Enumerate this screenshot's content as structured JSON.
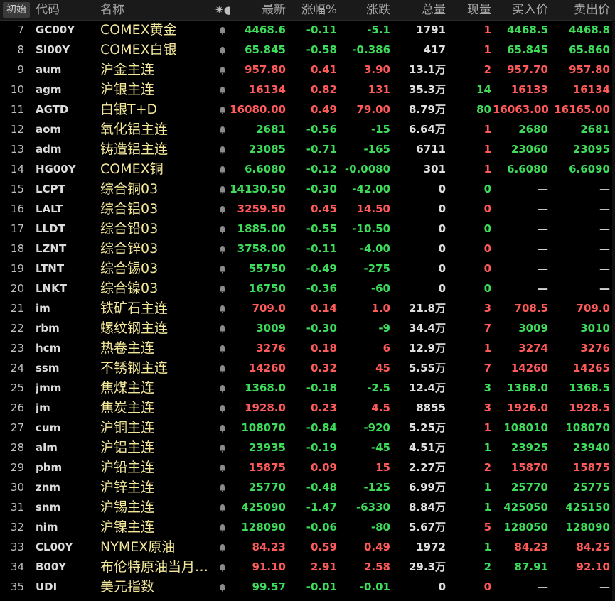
{
  "header": {
    "init_button": "初始",
    "code": "代码",
    "name": "名称",
    "flag": "✷●",
    "last": "最新",
    "pct": "涨幅%",
    "chg": "涨跌",
    "vol": "总量",
    "cur": "现量",
    "bid": "买入价",
    "ask": "卖出价"
  },
  "colors": {
    "up": "#ff5a5a",
    "down": "#3ddc5a",
    "name": "#f3e79a",
    "background": "#000000"
  },
  "rows": [
    {
      "idx": "7",
      "code": "GC00Y",
      "name": "COMEX黄金",
      "last": "4468.6",
      "pct": "-0.11",
      "chg": "-5.1",
      "vol": "1791",
      "cur": "1",
      "bid": "4468.5",
      "ask": "4468.8",
      "dir": "down",
      "cur_dir": "up",
      "bid_dir": "down",
      "ask_dir": "down"
    },
    {
      "idx": "8",
      "code": "SI00Y",
      "name": "COMEX白银",
      "last": "65.845",
      "pct": "-0.58",
      "chg": "-0.386",
      "vol": "417",
      "cur": "1",
      "bid": "65.845",
      "ask": "65.860",
      "dir": "down",
      "cur_dir": "up",
      "bid_dir": "down",
      "ask_dir": "down"
    },
    {
      "idx": "9",
      "code": "aum",
      "name": "沪金主连",
      "last": "957.80",
      "pct": "0.41",
      "chg": "3.90",
      "vol": "13.1万",
      "cur": "2",
      "bid": "957.70",
      "ask": "957.80",
      "dir": "up",
      "cur_dir": "up",
      "bid_dir": "up",
      "ask_dir": "up"
    },
    {
      "idx": "10",
      "code": "agm",
      "name": "沪银主连",
      "last": "16134",
      "pct": "0.82",
      "chg": "131",
      "vol": "35.3万",
      "cur": "14",
      "bid": "16133",
      "ask": "16134",
      "dir": "up",
      "cur_dir": "down",
      "bid_dir": "up",
      "ask_dir": "up"
    },
    {
      "idx": "11",
      "code": "AGTD",
      "name": "白银T+D",
      "last": "16080.00",
      "pct": "0.49",
      "chg": "79.00",
      "vol": "8.79万",
      "cur": "80",
      "bid": "16063.00",
      "ask": "16165.00",
      "dir": "up",
      "cur_dir": "down",
      "bid_dir": "up",
      "ask_dir": "up"
    },
    {
      "idx": "12",
      "code": "aom",
      "name": "氧化铝主连",
      "last": "2681",
      "pct": "-0.56",
      "chg": "-15",
      "vol": "6.64万",
      "cur": "1",
      "bid": "2680",
      "ask": "2681",
      "dir": "down",
      "cur_dir": "up",
      "bid_dir": "down",
      "ask_dir": "down"
    },
    {
      "idx": "13",
      "code": "adm",
      "name": "铸造铝主连",
      "last": "23085",
      "pct": "-0.71",
      "chg": "-165",
      "vol": "6711",
      "cur": "1",
      "bid": "23060",
      "ask": "23095",
      "dir": "down",
      "cur_dir": "up",
      "bid_dir": "down",
      "ask_dir": "down"
    },
    {
      "idx": "14",
      "code": "HG00Y",
      "name": "COMEX铜",
      "last": "6.6080",
      "pct": "-0.12",
      "chg": "-0.0080",
      "vol": "301",
      "cur": "1",
      "bid": "6.6080",
      "ask": "6.6090",
      "dir": "down",
      "cur_dir": "up",
      "bid_dir": "down",
      "ask_dir": "down"
    },
    {
      "idx": "15",
      "code": "LCPT",
      "name": "综合铜03",
      "last": "14130.50",
      "pct": "-0.30",
      "chg": "-42.00",
      "vol": "0",
      "cur": "0",
      "bid": "—",
      "ask": "—",
      "dir": "down",
      "cur_dir": "down",
      "bid_dir": "flat",
      "ask_dir": "flat"
    },
    {
      "idx": "16",
      "code": "LALT",
      "name": "综合铝03",
      "last": "3259.50",
      "pct": "0.45",
      "chg": "14.50",
      "vol": "0",
      "cur": "0",
      "bid": "—",
      "ask": "—",
      "dir": "up",
      "cur_dir": "up",
      "bid_dir": "flat",
      "ask_dir": "flat"
    },
    {
      "idx": "17",
      "code": "LLDT",
      "name": "综合铅03",
      "last": "1885.00",
      "pct": "-0.55",
      "chg": "-10.50",
      "vol": "0",
      "cur": "0",
      "bid": "—",
      "ask": "—",
      "dir": "down",
      "cur_dir": "down",
      "bid_dir": "flat",
      "ask_dir": "flat"
    },
    {
      "idx": "18",
      "code": "LZNT",
      "name": "综合锌03",
      "last": "3758.00",
      "pct": "-0.11",
      "chg": "-4.00",
      "vol": "0",
      "cur": "0",
      "bid": "—",
      "ask": "—",
      "dir": "down",
      "cur_dir": "up",
      "bid_dir": "flat",
      "ask_dir": "flat"
    },
    {
      "idx": "19",
      "code": "LTNT",
      "name": "综合锡03",
      "last": "55750",
      "pct": "-0.49",
      "chg": "-275",
      "vol": "0",
      "cur": "0",
      "bid": "—",
      "ask": "—",
      "dir": "down",
      "cur_dir": "up",
      "bid_dir": "flat",
      "ask_dir": "flat"
    },
    {
      "idx": "20",
      "code": "LNKT",
      "name": "综合镍03",
      "last": "16750",
      "pct": "-0.36",
      "chg": "-60",
      "vol": "0",
      "cur": "0",
      "bid": "—",
      "ask": "—",
      "dir": "down",
      "cur_dir": "down",
      "bid_dir": "flat",
      "ask_dir": "flat"
    },
    {
      "idx": "21",
      "code": "im",
      "name": "铁矿石主连",
      "last": "709.0",
      "pct": "0.14",
      "chg": "1.0",
      "vol": "21.8万",
      "cur": "3",
      "bid": "708.5",
      "ask": "709.0",
      "dir": "up",
      "cur_dir": "up",
      "bid_dir": "up",
      "ask_dir": "up"
    },
    {
      "idx": "22",
      "code": "rbm",
      "name": "螺纹钢主连",
      "last": "3009",
      "pct": "-0.30",
      "chg": "-9",
      "vol": "34.4万",
      "cur": "7",
      "bid": "3009",
      "ask": "3010",
      "dir": "down",
      "cur_dir": "up",
      "bid_dir": "down",
      "ask_dir": "down"
    },
    {
      "idx": "23",
      "code": "hcm",
      "name": "热卷主连",
      "last": "3276",
      "pct": "0.18",
      "chg": "6",
      "vol": "12.9万",
      "cur": "1",
      "bid": "3274",
      "ask": "3276",
      "dir": "up",
      "cur_dir": "up",
      "bid_dir": "up",
      "ask_dir": "up"
    },
    {
      "idx": "24",
      "code": "ssm",
      "name": "不锈钢主连",
      "last": "14260",
      "pct": "0.32",
      "chg": "45",
      "vol": "5.55万",
      "cur": "7",
      "bid": "14260",
      "ask": "14265",
      "dir": "up",
      "cur_dir": "up",
      "bid_dir": "up",
      "ask_dir": "up"
    },
    {
      "idx": "25",
      "code": "jmm",
      "name": "焦煤主连",
      "last": "1368.0",
      "pct": "-0.18",
      "chg": "-2.5",
      "vol": "12.4万",
      "cur": "3",
      "bid": "1368.0",
      "ask": "1368.5",
      "dir": "down",
      "cur_dir": "down",
      "bid_dir": "down",
      "ask_dir": "down"
    },
    {
      "idx": "26",
      "code": "jm",
      "name": "焦炭主连",
      "last": "1928.0",
      "pct": "0.23",
      "chg": "4.5",
      "vol": "8855",
      "cur": "3",
      "bid": "1926.0",
      "ask": "1928.5",
      "dir": "up",
      "cur_dir": "up",
      "bid_dir": "up",
      "ask_dir": "up"
    },
    {
      "idx": "27",
      "code": "cum",
      "name": "沪铜主连",
      "last": "108070",
      "pct": "-0.84",
      "chg": "-920",
      "vol": "5.25万",
      "cur": "1",
      "bid": "108010",
      "ask": "108070",
      "dir": "down",
      "cur_dir": "up",
      "bid_dir": "down",
      "ask_dir": "down"
    },
    {
      "idx": "28",
      "code": "alm",
      "name": "沪铝主连",
      "last": "23935",
      "pct": "-0.19",
      "chg": "-45",
      "vol": "4.51万",
      "cur": "1",
      "bid": "23925",
      "ask": "23940",
      "dir": "down",
      "cur_dir": "down",
      "bid_dir": "down",
      "ask_dir": "down"
    },
    {
      "idx": "29",
      "code": "pbm",
      "name": "沪铅主连",
      "last": "15875",
      "pct": "0.09",
      "chg": "15",
      "vol": "2.27万",
      "cur": "2",
      "bid": "15870",
      "ask": "15875",
      "dir": "up",
      "cur_dir": "up",
      "bid_dir": "up",
      "ask_dir": "up"
    },
    {
      "idx": "30",
      "code": "znm",
      "name": "沪锌主连",
      "last": "25770",
      "pct": "-0.48",
      "chg": "-125",
      "vol": "6.99万",
      "cur": "1",
      "bid": "25770",
      "ask": "25775",
      "dir": "down",
      "cur_dir": "down",
      "bid_dir": "down",
      "ask_dir": "down"
    },
    {
      "idx": "31",
      "code": "snm",
      "name": "沪锡主连",
      "last": "425090",
      "pct": "-1.47",
      "chg": "-6330",
      "vol": "8.84万",
      "cur": "1",
      "bid": "425050",
      "ask": "425150",
      "dir": "down",
      "cur_dir": "down",
      "bid_dir": "down",
      "ask_dir": "down"
    },
    {
      "idx": "32",
      "code": "nim",
      "name": "沪镍主连",
      "last": "128090",
      "pct": "-0.06",
      "chg": "-80",
      "vol": "5.67万",
      "cur": "5",
      "bid": "128050",
      "ask": "128090",
      "dir": "down",
      "cur_dir": "up",
      "bid_dir": "down",
      "ask_dir": "down"
    },
    {
      "idx": "33",
      "code": "CL00Y",
      "name": "NYMEX原油",
      "last": "84.23",
      "pct": "0.59",
      "chg": "0.49",
      "vol": "1972",
      "cur": "1",
      "bid": "84.23",
      "ask": "84.25",
      "dir": "up",
      "cur_dir": "down",
      "bid_dir": "up",
      "ask_dir": "up"
    },
    {
      "idx": "34",
      "code": "B00Y",
      "name": "布伦特原油当月…",
      "last": "91.10",
      "pct": "2.91",
      "chg": "2.58",
      "vol": "29.3万",
      "cur": "2",
      "bid": "87.91",
      "ask": "92.10",
      "dir": "up",
      "cur_dir": "down",
      "bid_dir": "down",
      "ask_dir": "up"
    },
    {
      "idx": "35",
      "code": "UDI",
      "name": "美元指数",
      "last": "99.57",
      "pct": "-0.01",
      "chg": "-0.01",
      "vol": "0",
      "cur": "0",
      "bid": "—",
      "ask": "—",
      "dir": "down",
      "cur_dir": "up",
      "bid_dir": "flat",
      "ask_dir": "flat"
    }
  ]
}
